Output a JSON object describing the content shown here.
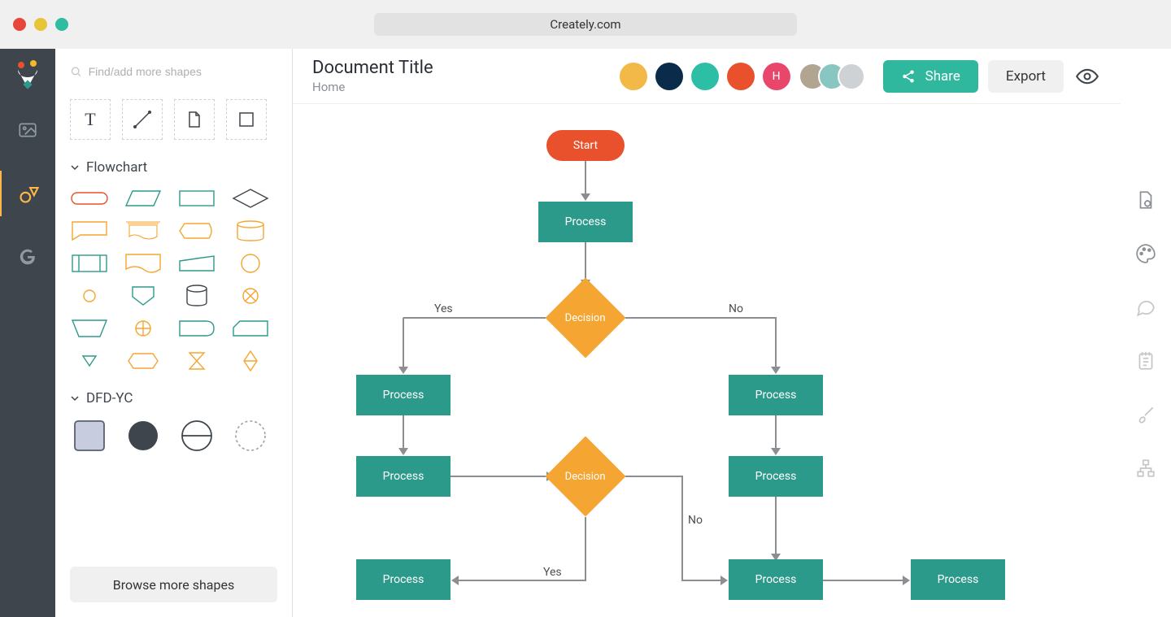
{
  "browser": {
    "url": "Creately.com"
  },
  "header": {
    "title": "Document Title",
    "breadcrumb": "Home",
    "share_label": "Share",
    "export_label": "Export"
  },
  "avatars": {
    "initial": "H",
    "colors": {
      "a1_bg": "#f2b848",
      "a2_bg": "#0b2b4a",
      "a3_bg": "#2cbfa5",
      "a4_bg": "#e9512d",
      "a5_bg": "#e9466c",
      "g1_bg": "#b1a591",
      "g2_bg": "#89c6c1",
      "g3_bg": "#cfd2d5"
    }
  },
  "search": {
    "placeholder": "Find/add more shapes"
  },
  "groups": {
    "flowchart_label": "Flowchart",
    "dfdyc_label": "DFD-YC"
  },
  "browse_label": "Browse more shapes",
  "chart_data": {
    "type": "flowchart",
    "nodes": {
      "start": "Start",
      "process": "Process",
      "decision": "Decision"
    },
    "edge_labels": {
      "yes": "Yes",
      "no": "No"
    },
    "structure": [
      {
        "id": "n1",
        "type": "start",
        "label": "Start"
      },
      {
        "id": "n2",
        "type": "process",
        "label": "Process",
        "from": "n1"
      },
      {
        "id": "n3",
        "type": "decision",
        "label": "Decision",
        "from": "n2"
      },
      {
        "id": "n4",
        "type": "process",
        "label": "Process",
        "from": "n3",
        "edge": "Yes"
      },
      {
        "id": "n5",
        "type": "process",
        "label": "Process",
        "from": "n3",
        "edge": "No"
      },
      {
        "id": "n6",
        "type": "process",
        "label": "Process",
        "from": "n4"
      },
      {
        "id": "n7",
        "type": "process",
        "label": "Process",
        "from": "n5"
      },
      {
        "id": "n8",
        "type": "decision",
        "label": "Decision",
        "from": "n6"
      },
      {
        "id": "n9",
        "type": "process",
        "label": "Process",
        "from": "n8",
        "edge": "Yes"
      },
      {
        "id": "n10",
        "type": "process",
        "label": "Process",
        "from": "n8",
        "edge": "No"
      },
      {
        "id": "n11",
        "type": "process",
        "label": "Process",
        "from": "n10"
      }
    ]
  },
  "left_rail_icons": [
    "image-icon",
    "shapes-icon",
    "google-icon"
  ],
  "right_rail_icons": [
    "doc-settings-icon",
    "palette-icon",
    "comment-icon",
    "notes-icon",
    "brush-icon",
    "tree-icon"
  ],
  "colors": {
    "accent_share": "#30b89f",
    "accent_start": "#e9512d",
    "accent_process": "#2c9a8b",
    "accent_decision": "#f5a531"
  }
}
